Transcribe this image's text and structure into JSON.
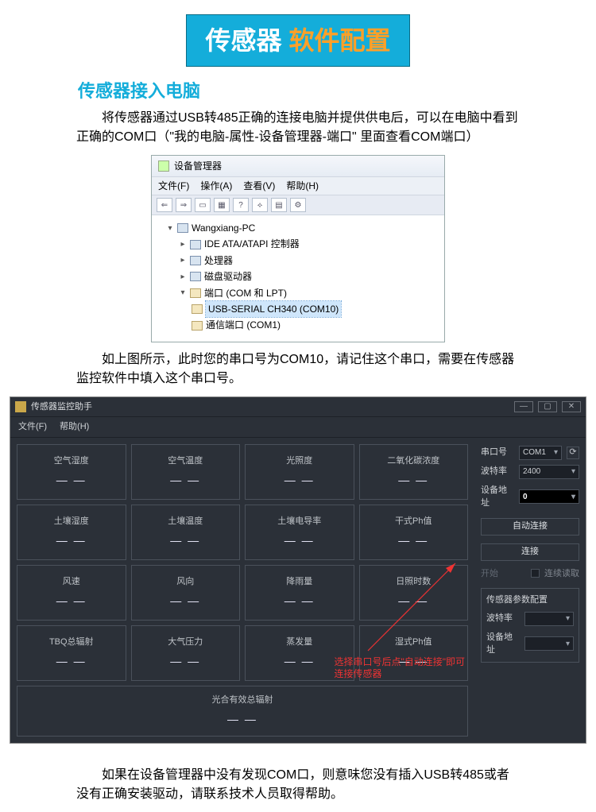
{
  "banner": {
    "left": "传感器",
    "right": "软件配置"
  },
  "section1": {
    "title": "传感器接入电脑",
    "p1": "将传感器通过USB转485正确的连接电脑并提供供电后，可以在电脑中看到正确的COM口（\"我的电脑-属性-设备管理器-端口\" 里面查看COM端口）",
    "p2": "如上图所示，此时您的串口号为COM10，请记住这个串口，需要在传感器监控软件中填入这个串口号。",
    "p3": "如果在设备管理器中没有发现COM口，则意味您没有插入USB转485或者没有正确安装驱动，请联系技术人员取得帮助。"
  },
  "devmgr": {
    "title": "设备管理器",
    "menu": [
      "文件(F)",
      "操作(A)",
      "查看(V)",
      "帮助(H)"
    ],
    "toolbar_glyphs": [
      "⇐",
      "⇒",
      "▭",
      "▦",
      "?",
      "⟡",
      "▤",
      "⚙"
    ],
    "root": "Wangxiang-PC",
    "nodes": [
      "IDE ATA/ATAPI 控制器",
      "处理器",
      "磁盘驱动器"
    ],
    "ports_label": "端口 (COM 和 LPT)",
    "ports": [
      {
        "name": "USB-SERIAL CH340 (COM10)",
        "selected": true
      },
      {
        "name": "通信端口 (COM1)",
        "selected": false
      }
    ]
  },
  "mon": {
    "title": "传感器监控助手",
    "menu": [
      "文件(F)",
      "帮助(H)"
    ],
    "win_glyphs": [
      "—",
      "▢",
      "✕"
    ],
    "tiles": [
      [
        "空气湿度",
        "空气温度",
        "光照度",
        "二氧化碳浓度"
      ],
      [
        "土壤湿度",
        "土壤温度",
        "土壤电导率",
        "干式Ph值"
      ],
      [
        "风速",
        "风向",
        "降雨量",
        "日照时数"
      ],
      [
        "TBQ总辐射",
        "大气压力",
        "蒸发量",
        "湿式Ph值"
      ]
    ],
    "tile_value": "— —",
    "wide_tile": "光合有效总辐射",
    "side": {
      "labels": {
        "port": "串口号",
        "baud": "波特率",
        "addr": "设备地址"
      },
      "port": "COM1",
      "port_refresh": "⟳",
      "baud": "2400",
      "addr": "0",
      "btn_auto": "自动连接",
      "btn_conn": "连接",
      "dim_label": "开始",
      "chk_label": "连续读取",
      "group_title": "传感器参数配置",
      "baud2_val": "",
      "addr2_val": ""
    },
    "annot": [
      "选择串口号后点\"自动连接\"即可",
      "连接传感器"
    ]
  }
}
